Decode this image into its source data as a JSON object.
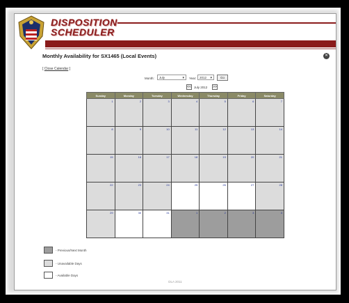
{
  "header": {
    "brand_line1": "DISPOSITION",
    "brand_line2": "SCHEDULER"
  },
  "page_title": "Monthly Availability for SX1465 (Local Events)",
  "close_calendar": {
    "open_bracket": "[",
    "label": "Close Calendar",
    "close_bracket": "]"
  },
  "controls": {
    "month_label": "Month:",
    "month_value": "July",
    "year_label": "Year:",
    "year_value": "2012",
    "go_label": "Go",
    "prev_symbol": "<<",
    "next_symbol": ">>",
    "current_month": "July 2012"
  },
  "calendar": {
    "weekdays": [
      "Sunday",
      "Monday",
      "Tuesday",
      "Wednesday",
      "Thursday",
      "Friday",
      "Saturday"
    ],
    "weeks": [
      [
        {
          "day": "1",
          "status": "unavailable"
        },
        {
          "day": "2",
          "status": "unavailable"
        },
        {
          "day": "3",
          "status": "unavailable"
        },
        {
          "day": "4",
          "status": "unavailable"
        },
        {
          "day": "5",
          "status": "unavailable"
        },
        {
          "day": "6",
          "status": "unavailable"
        },
        {
          "day": "7",
          "status": "unavailable"
        }
      ],
      [
        {
          "day": "8",
          "status": "unavailable"
        },
        {
          "day": "9",
          "status": "unavailable"
        },
        {
          "day": "10",
          "status": "unavailable"
        },
        {
          "day": "11",
          "status": "unavailable"
        },
        {
          "day": "12",
          "status": "unavailable"
        },
        {
          "day": "13",
          "status": "unavailable"
        },
        {
          "day": "14",
          "status": "unavailable"
        }
      ],
      [
        {
          "day": "15",
          "status": "unavailable"
        },
        {
          "day": "16",
          "status": "unavailable"
        },
        {
          "day": "17",
          "status": "unavailable"
        },
        {
          "day": "18",
          "status": "unavailable"
        },
        {
          "day": "19",
          "status": "unavailable"
        },
        {
          "day": "20",
          "status": "unavailable"
        },
        {
          "day": "21",
          "status": "unavailable"
        }
      ],
      [
        {
          "day": "22",
          "status": "unavailable"
        },
        {
          "day": "23",
          "status": "unavailable"
        },
        {
          "day": "24",
          "status": "unavailable"
        },
        {
          "day": "25",
          "status": "available"
        },
        {
          "day": "26",
          "status": "available"
        },
        {
          "day": "27",
          "status": "available"
        },
        {
          "day": "28",
          "status": "unavailable"
        }
      ],
      [
        {
          "day": "29",
          "status": "unavailable"
        },
        {
          "day": "30",
          "status": "available"
        },
        {
          "day": "31",
          "status": "available"
        },
        {
          "day": "1",
          "status": "prevnext"
        },
        {
          "day": "2",
          "status": "prevnext"
        },
        {
          "day": "3",
          "status": "prevnext"
        },
        {
          "day": "4",
          "status": "prevnext"
        }
      ]
    ]
  },
  "legend": [
    {
      "label": "- Previous/Next Month",
      "color": "#9d9d9d"
    },
    {
      "label": "- Unavailable Days",
      "color": "#dcdcdc"
    },
    {
      "label": "- Available Days",
      "color": "#ffffff"
    }
  ],
  "footer": "DLA 2011"
}
